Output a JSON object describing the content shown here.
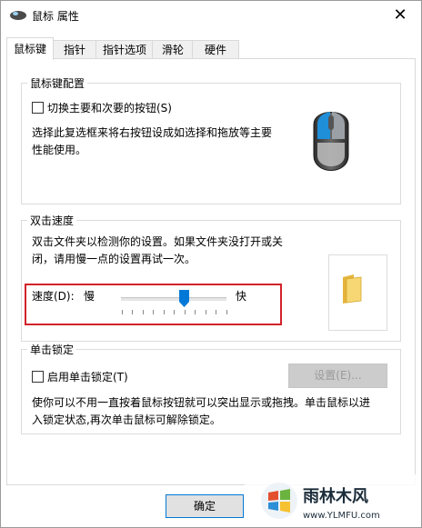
{
  "window": {
    "title": "鼠标 属性",
    "close_glyph": "✕"
  },
  "tabs": [
    "鼠标键",
    "指针",
    "指针选项",
    "滑轮",
    "硬件"
  ],
  "active_tab": 0,
  "button_config": {
    "group_title": "鼠标键配置",
    "checkbox_label": "切换主要和次要的按钮(S)",
    "checked": false,
    "desc_line1": "选择此复选框来将右按钮设成如选择和拖放等主要",
    "desc_line2": "性能使用。"
  },
  "double_click": {
    "group_title": "双击速度",
    "desc_line1": "双击文件夹以检测你的设置。如果文件夹没打开或关",
    "desc_line2": "闭，请用慢一点的设置再试一次。",
    "speed_label": "速度(D):",
    "slow_label": "慢",
    "fast_label": "快",
    "speed_value": 0.6
  },
  "click_lock": {
    "group_title": "单击锁定",
    "checkbox_label": "启用单击锁定(T)",
    "checked": false,
    "settings_button": "设置(E)...",
    "desc_line1": "使你可以不用一直按着鼠标按钮就可以突出显示或拖拽。单击鼠标以进",
    "desc_line2": "入锁定状态,再次单击鼠标可解除锁定。"
  },
  "footer": {
    "ok_button": "确定"
  },
  "watermark": {
    "brand": "雨林木风",
    "url": "www.YLMFU.com"
  },
  "colors": {
    "accent": "#0078d7",
    "highlight_box": "#d2232a"
  }
}
